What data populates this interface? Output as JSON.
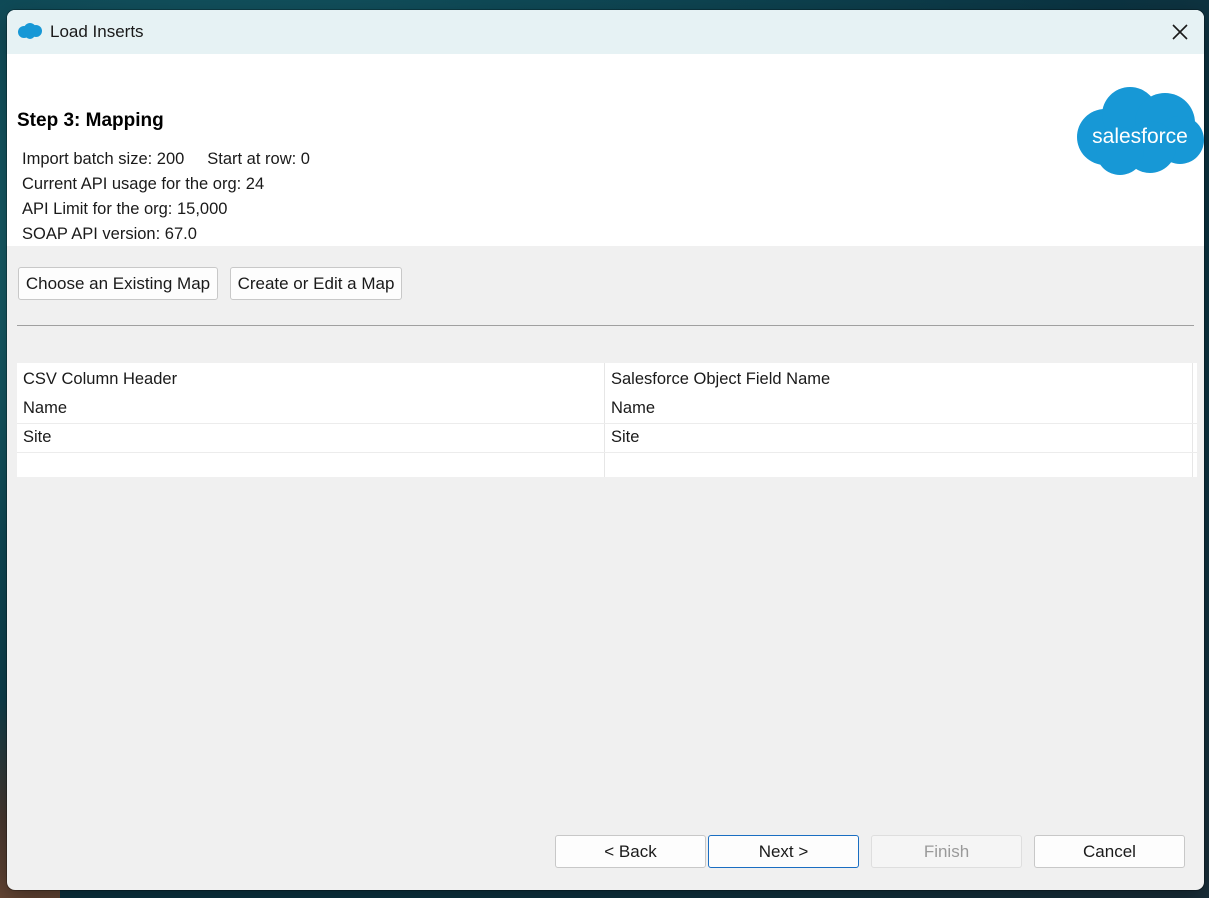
{
  "window": {
    "title": "Load Inserts"
  },
  "header": {
    "step_title": "Step 3: Mapping",
    "info_lines": [
      "Import batch size: 200     Start at row: 0",
      "Current API usage for the org: 24",
      "API Limit for the org: 15,000",
      "SOAP API version: 67.0"
    ],
    "logo_text": "salesforce"
  },
  "mapping_buttons": {
    "choose_existing": "Choose an Existing Map",
    "create_edit": "Create or Edit a Map"
  },
  "mapping_table": {
    "headers": [
      "CSV Column Header",
      "Salesforce Object Field Name"
    ],
    "rows": [
      [
        "Name",
        "Name"
      ],
      [
        "Site",
        "Site"
      ],
      [
        "",
        ""
      ]
    ]
  },
  "footer": {
    "back": "< Back",
    "next": "Next >",
    "finish": "Finish",
    "cancel": "Cancel"
  },
  "colors": {
    "salesforce_blue": "#1798d6",
    "titlebar_bg": "#e6f2f4",
    "default_button_border": "#1a6ec2"
  },
  "icons": {
    "title_icon": "salesforce-cloud-icon",
    "close": "close-icon"
  }
}
